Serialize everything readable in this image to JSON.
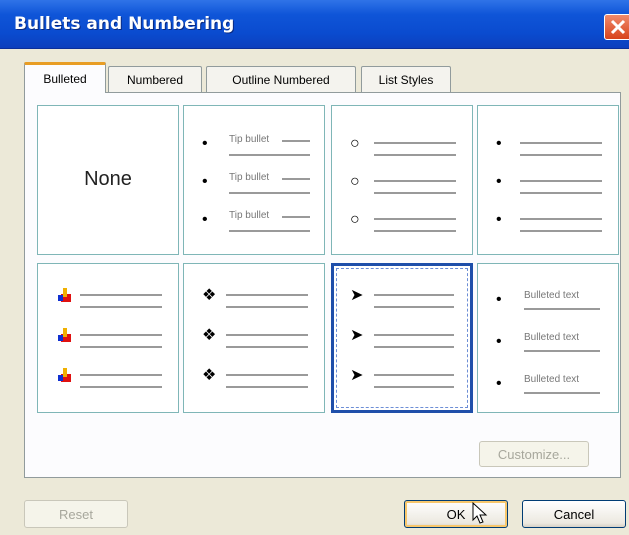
{
  "window": {
    "title": "Bullets and Numbering"
  },
  "tabs": [
    {
      "label": "Bulleted",
      "active": true
    },
    {
      "label": "Numbered",
      "active": false
    },
    {
      "label": "Outline Numbered",
      "active": false
    },
    {
      "label": "List Styles",
      "active": false
    }
  ],
  "gallery": {
    "none_label": "None",
    "tip_text": "Tip bullet",
    "bulleted_text": "Bulleted text",
    "selected_index": 6
  },
  "buttons": {
    "customize": "Customize...",
    "reset": "Reset",
    "ok": "OK",
    "cancel": "Cancel"
  },
  "colors": {
    "titlebar": "#0a4bcf",
    "active_tab_accent": "#e89d24",
    "selection_border": "#1f4faa"
  }
}
